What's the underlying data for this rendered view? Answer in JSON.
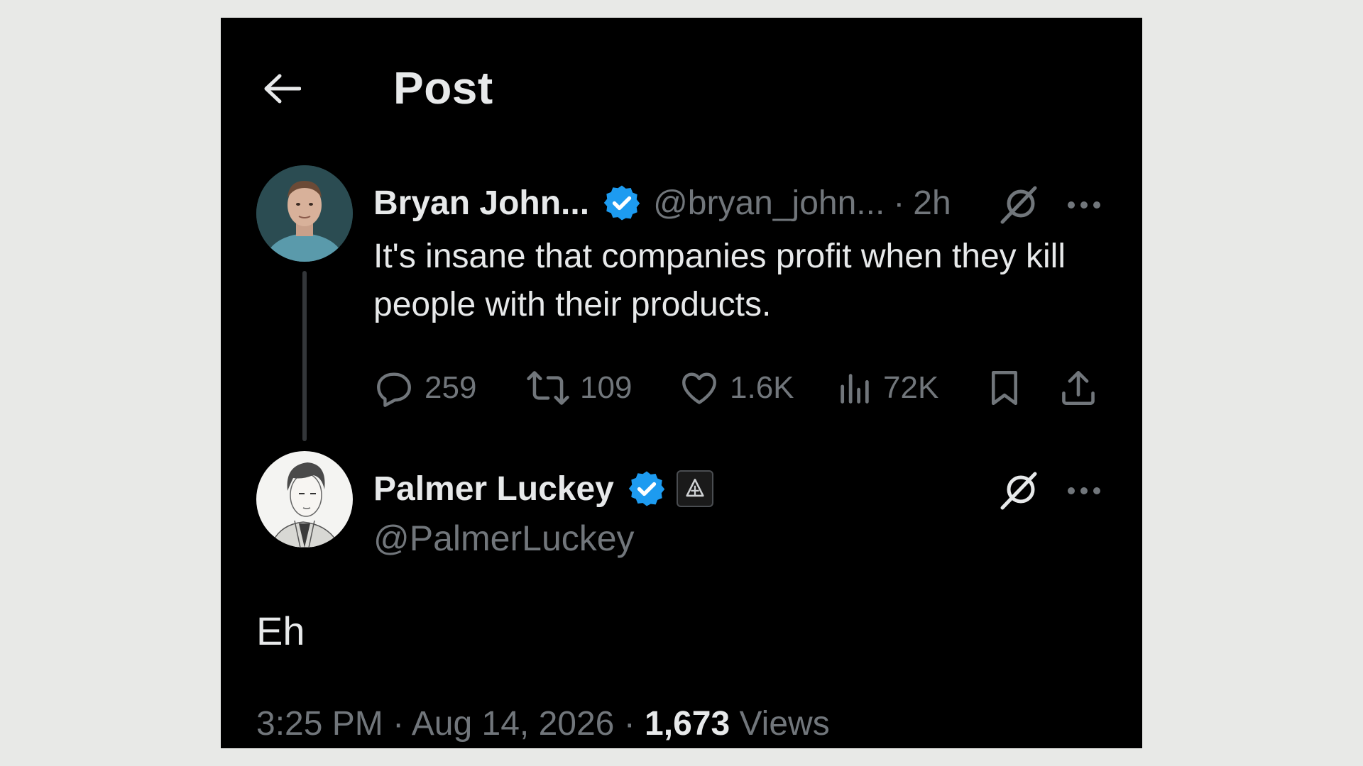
{
  "header": {
    "title": "Post"
  },
  "parent_post": {
    "display_name": "Bryan John...",
    "handle": "@bryan_john...",
    "separator": "·",
    "time": "2h",
    "text": "It's insane that companies profit when they kill people with their products.",
    "stats": {
      "replies": "259",
      "reposts": "109",
      "likes": "1.6K",
      "views": "72K"
    }
  },
  "reply_post": {
    "display_name": "Palmer Luckey",
    "handle": "@PalmerLuckey",
    "text": "Eh",
    "time": "3:25 PM",
    "separator": "·",
    "date": "Aug 14, 2026",
    "separator2": "·",
    "views_count": "1,673",
    "views_label": "Views"
  },
  "colors": {
    "background": "#000000",
    "outer_background": "#e8e9e7",
    "text_primary": "#e7e9ea",
    "text_secondary": "#71767b",
    "verified_blue": "#1d9bf0"
  },
  "icons": [
    "back-arrow-icon",
    "verified-badge-icon",
    "grok-icon",
    "more-icon",
    "reply-icon",
    "repost-icon",
    "like-icon",
    "views-icon",
    "bookmark-icon",
    "share-icon",
    "affiliate-badge-icon"
  ]
}
